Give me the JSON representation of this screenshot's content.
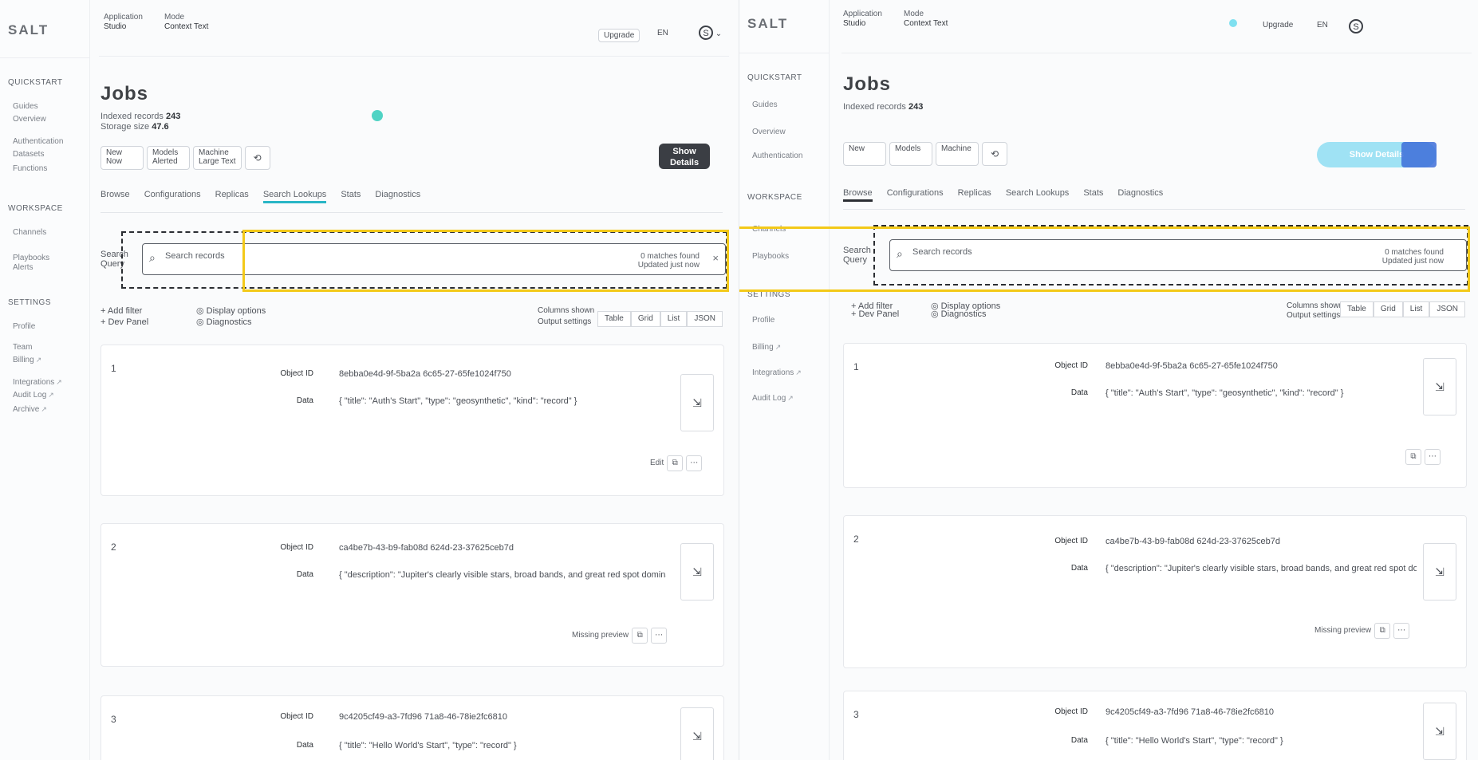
{
  "app": {
    "brand": "SALT",
    "accent_color": "#29b6c6",
    "selection_color": "#f3c919"
  },
  "sidebar": {
    "sections": [
      {
        "title": "Quickstart",
        "items": [
          "Guides",
          "Overview",
          "Authentication",
          "Datasets",
          "Functions"
        ]
      },
      {
        "title": "Workspace",
        "items": [
          "Channels",
          "Playbooks",
          "Alerts"
        ]
      },
      {
        "title": "Settings",
        "items": [
          "Profile",
          "Team",
          "Billing",
          "Integrations",
          "Audit Log",
          "Archive"
        ]
      }
    ]
  },
  "topbar": {
    "crumb_a_label": "Application",
    "crumb_a_value": "Studio",
    "crumb_b_label": "Mode",
    "crumb_b_value": "Context Text",
    "toggle_label": "Upgrade",
    "lang": "EN",
    "avatar": "S"
  },
  "page": {
    "title": "Jobs",
    "meta_line1_label": "Indexed records",
    "meta_line1_value": "243",
    "meta_line2_label": "Storage size",
    "meta_line2_value": "47.6",
    "filters": [
      {
        "top": "New",
        "bottom": "Now"
      },
      {
        "top": "Models",
        "bottom": "Alerted"
      },
      {
        "top": "Machine",
        "bottom": "Large Text"
      }
    ],
    "show_button": "Show Details",
    "tabs": [
      "Browse",
      "Configurations",
      "Replicas",
      "Search Lookups",
      "Stats",
      "Diagnostics"
    ],
    "active_tab": 3
  },
  "search": {
    "label": "Search",
    "sublabel": "Query",
    "placeholder": "Search records",
    "right_top": "0 matches found",
    "right_bottom": "Updated just now"
  },
  "actions": {
    "left1": "Add filter",
    "left2": "Dev Panel",
    "mid1": "Display options",
    "mid2": "Diagnostics",
    "right_label1": "Columns shown",
    "right_label2": "Output settings",
    "toggles": [
      "Table",
      "Grid",
      "List",
      "JSON"
    ]
  },
  "cards": [
    {
      "num": "1",
      "id_label": "Object ID",
      "id_value": "8ebba0e4d-9f-5ba2a 6c65-27-65fe1024f750",
      "data_label": "Data",
      "data_value": "{ \"title\": \"Auth's Start\", \"type\": \"geosynthetic\", \"kind\": \"record\" }",
      "foot": "Edit"
    },
    {
      "num": "2",
      "id_label": "Object ID",
      "id_value": "ca4be7b-43-b9-fab08d 624d-23-37625ceb7d",
      "data_label": "Data",
      "data_value": "{ \"description\": \"Jupiter's clearly visible stars, broad bands, and great red spot dominate the northern hemisphere imagery\" }",
      "foot": "Missing preview"
    },
    {
      "num": "3",
      "id_label": "Object ID",
      "id_value": "9c4205cf49-a3-7fd96 71a8-46-78ie2fc6810",
      "data_label": "Data",
      "data_value": "{ \"title\": \"Hello World's Start\", \"type\": \"record\" }",
      "foot": ""
    }
  ]
}
